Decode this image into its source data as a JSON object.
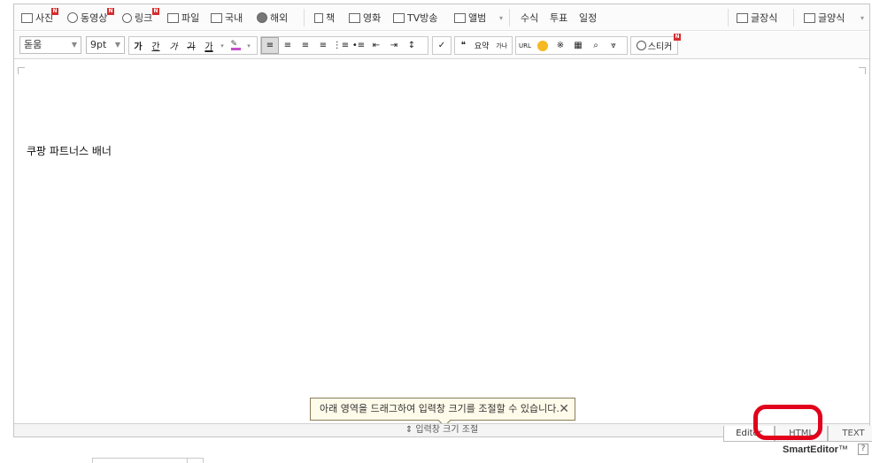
{
  "toolbar_top": {
    "items": [
      {
        "label": "사진",
        "icon": "photo-icon",
        "new": true
      },
      {
        "label": "동영상",
        "icon": "video-icon",
        "new": true
      },
      {
        "label": "링크",
        "icon": "link-icon",
        "new": true
      },
      {
        "label": "파일",
        "icon": "file-icon",
        "new": false
      },
      {
        "label": "국내",
        "icon": "domestic-icon",
        "new": false
      },
      {
        "label": "해외",
        "icon": "globe-icon",
        "new": false
      },
      {
        "label": "책",
        "icon": "book-icon",
        "new": false
      },
      {
        "label": "영화",
        "icon": "movie-icon",
        "new": false
      },
      {
        "label": "TV방송",
        "icon": "tv-icon",
        "new": false
      },
      {
        "label": "앨범",
        "icon": "album-icon",
        "new": false
      },
      {
        "label": "수식"
      },
      {
        "label": "투표"
      },
      {
        "label": "일정"
      },
      {
        "label": "글장식",
        "icon": "pen-icon"
      },
      {
        "label": "글양식",
        "icon": "template-icon"
      }
    ],
    "new_badge": "N"
  },
  "toolbar_format": {
    "font": "돋움",
    "size": "9pt",
    "bold": "가",
    "underline": "간",
    "italic": "가",
    "strike": "가",
    "font_color": "가",
    "quote": "❝",
    "summary": "요약",
    "spell": "가나",
    "url": "URL",
    "sticker": "스티커"
  },
  "content": {
    "text": "쿠팡 파트너스 배너"
  },
  "tooltip": {
    "text": "아래 영역을 드래그하여 입력창 크기를 조절할 수 있습니다.",
    "close": "✕"
  },
  "resize_bar": {
    "label": "⇕ 입력창 크기 조절"
  },
  "mode_tabs": [
    "Editor",
    "HTML",
    "TEXT"
  ],
  "active_tab": "Editor",
  "brand": {
    "name": "SmartEditor",
    "tm": "™",
    "help": "?"
  },
  "colors": {
    "highlight_circle": "#e2001a",
    "new_badge": "#d62d2d",
    "tooltip_bg": "#fffbea"
  }
}
